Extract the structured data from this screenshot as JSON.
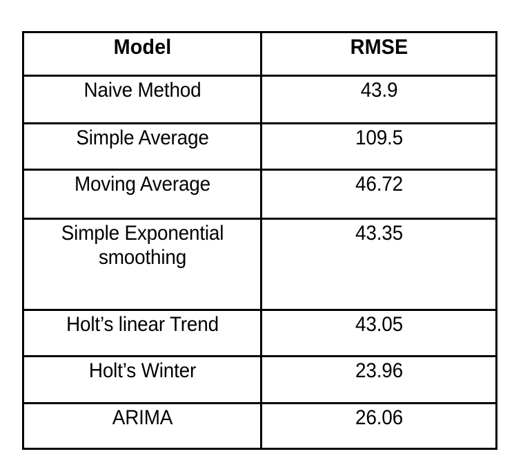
{
  "table": {
    "caption": "",
    "columns": [
      {
        "key": "model",
        "label": "Model"
      },
      {
        "key": "rmse",
        "label": "RMSE"
      }
    ],
    "rows": [
      {
        "model": "Naive Method",
        "rmse": "43.9"
      },
      {
        "model": "Simple Average",
        "rmse": "109.5"
      },
      {
        "model": "Moving Average",
        "rmse": "46.72"
      },
      {
        "model": "Simple Exponential smoothing",
        "rmse": "43.35"
      },
      {
        "model": "Holt’s linear Trend",
        "rmse": "43.05"
      },
      {
        "model": "Holt’s Winter",
        "rmse": "23.96"
      },
      {
        "model": "ARIMA",
        "rmse": "26.06"
      }
    ]
  },
  "chart_data": {
    "type": "table",
    "title": "",
    "xlabel": "Model",
    "ylabel": "RMSE",
    "categories": [
      "Naive Method",
      "Simple Average",
      "Moving Average",
      "Simple Exponential smoothing",
      "Holt’s linear Trend",
      "Holt’s Winter",
      "ARIMA"
    ],
    "values": [
      43.9,
      109.5,
      46.72,
      43.35,
      43.05,
      23.96,
      26.06
    ],
    "series": [
      {
        "name": "RMSE",
        "values": [
          43.9,
          109.5,
          46.72,
          43.35,
          43.05,
          23.96,
          26.06
        ]
      }
    ],
    "grid": true,
    "legend": "none"
  },
  "style": {
    "border_color": "#000000",
    "background_color": "#ffffff",
    "text_color": "#000000"
  }
}
